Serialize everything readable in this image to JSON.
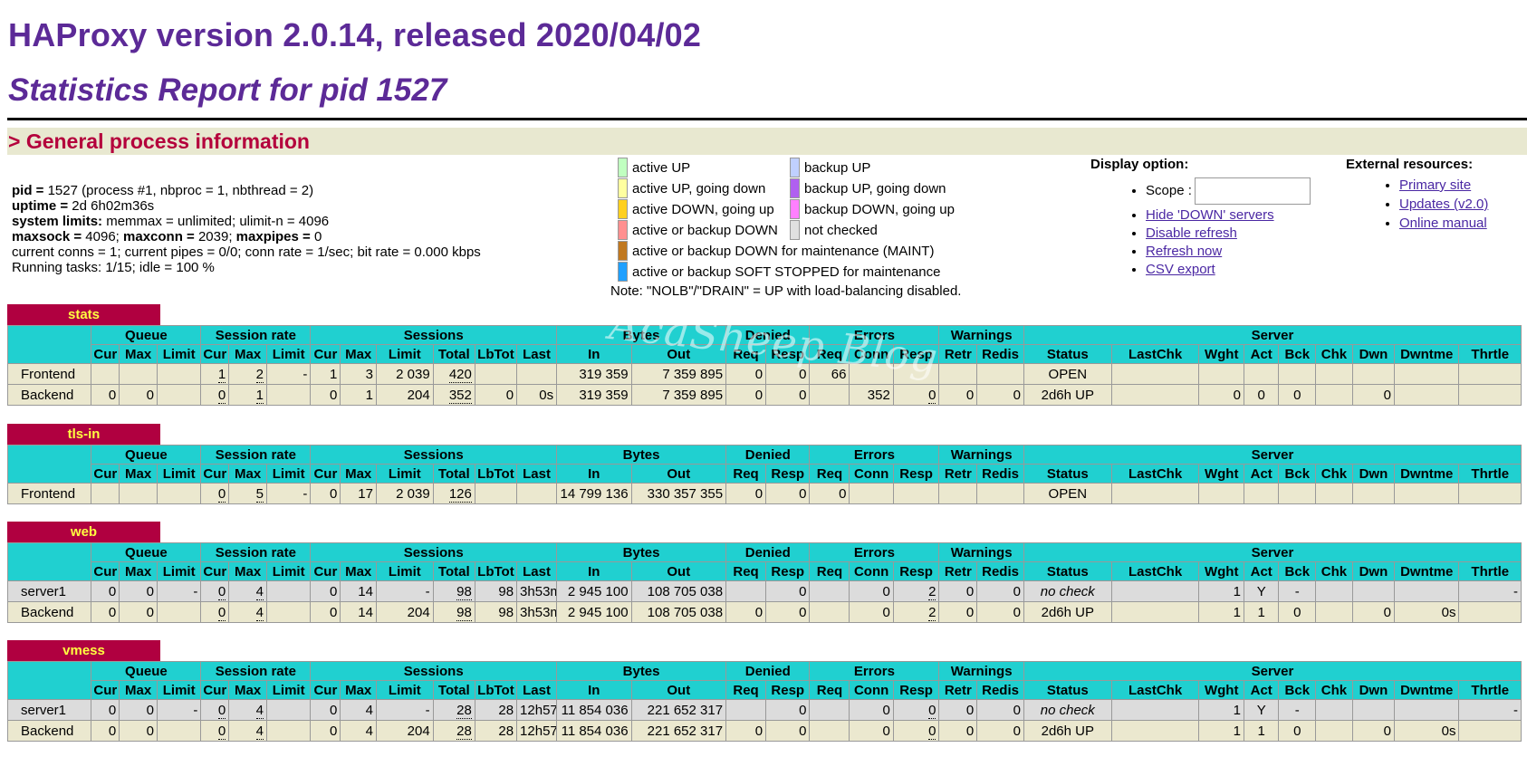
{
  "page": {
    "title": "HAProxy version 2.0.14, released 2020/04/02",
    "subtitle": "Statistics Report for pid 1527",
    "section_title": "> General process information"
  },
  "process": {
    "pid_label": "pid =",
    "pid_value": " 1527 (process #1, nbproc = 1, nbthread = 2)",
    "uptime_label": "uptime =",
    "uptime_value": " 2d 6h02m36s",
    "limits_label": "system limits:",
    "limits_value": " memmax = unlimited; ulimit-n = 4096",
    "maxsock_label": "maxsock =",
    "maxsock_value": " 4096; ",
    "maxconn_label": "maxconn =",
    "maxconn_value": " 2039; ",
    "maxpipes_label": "maxpipes =",
    "maxpipes_value": " 0",
    "conns_line": "current conns = 1; current pipes = 0/0; conn rate = 1/sec; bit rate = 0.000 kbps",
    "tasks_line": "Running tasks: 1/15; idle = 100 %"
  },
  "legend": {
    "col1": [
      {
        "label": "active UP",
        "color": "#c0ffc0"
      },
      {
        "label": "active UP, going down",
        "color": "#ffffa0"
      },
      {
        "label": "active DOWN, going up",
        "color": "#ffd020"
      },
      {
        "label": "active or backup DOWN",
        "color": "#ff9090"
      }
    ],
    "col2": [
      {
        "label": "backup UP",
        "color": "#c0d0ff"
      },
      {
        "label": "backup UP, going down",
        "color": "#b060f0"
      },
      {
        "label": "backup DOWN, going up",
        "color": "#ff80ff"
      },
      {
        "label": "not checked",
        "color": "#e0e0e0"
      }
    ],
    "wide": [
      {
        "label": "active or backup DOWN for maintenance (MAINT)",
        "color": "#c07820"
      },
      {
        "label": "active or backup SOFT STOPPED for maintenance",
        "color": "#20a0ff"
      }
    ],
    "note": "Note: \"NOLB\"/\"DRAIN\" = UP with load-balancing disabled."
  },
  "display": {
    "title": "Display option:",
    "scope_label": "Scope :",
    "scope_value": "",
    "links": [
      "Hide 'DOWN' servers",
      "Disable refresh",
      "Refresh now",
      "CSV export"
    ]
  },
  "external": {
    "title": "External resources:",
    "links": [
      "Primary site",
      "Updates (v2.0)",
      "Online manual"
    ]
  },
  "watermark": "AcaSheep Blog",
  "header_groups": [
    "Queue",
    "Session rate",
    "Sessions",
    "Bytes",
    "Denied",
    "Errors",
    "Warnings",
    "Server"
  ],
  "header_cols": [
    "Cur",
    "Max",
    "Limit",
    "Cur",
    "Max",
    "Limit",
    "Cur",
    "Max",
    "Limit",
    "Total",
    "LbTot",
    "Last",
    "In",
    "Out",
    "Req",
    "Resp",
    "Req",
    "Conn",
    "Resp",
    "Retr",
    "Redis",
    "Status",
    "LastChk",
    "Wght",
    "Act",
    "Bck",
    "Chk",
    "Dwn",
    "Dwntme",
    "Thrtle"
  ],
  "proxies": [
    {
      "name": "stats",
      "rows": [
        {
          "kind": "fe",
          "cells": [
            "Frontend",
            "",
            "",
            "",
            "1",
            "2",
            "-",
            "1",
            "3",
            "2 039",
            "420",
            "",
            "",
            "319 359",
            "7 359 895",
            "0",
            "0",
            "66",
            "",
            "",
            "",
            "",
            "OPEN",
            "",
            "",
            "",
            "",
            "",
            "",
            "",
            ""
          ]
        },
        {
          "kind": "be",
          "cells": [
            "Backend",
            "0",
            "0",
            "",
            "0",
            "1",
            "",
            "0",
            "1",
            "204",
            "352",
            "0",
            "0s",
            "319 359",
            "7 359 895",
            "0",
            "0",
            "",
            "352",
            "0",
            "0",
            "0",
            "2d6h UP",
            "",
            "0",
            "0",
            "0",
            "",
            "0",
            "",
            ""
          ]
        }
      ]
    },
    {
      "name": "tls-in",
      "rows": [
        {
          "kind": "fe",
          "cells": [
            "Frontend",
            "",
            "",
            "",
            "0",
            "5",
            "-",
            "0",
            "17",
            "2 039",
            "126",
            "",
            "",
            "14 799 136",
            "330 357 355",
            "0",
            "0",
            "0",
            "",
            "",
            "",
            "",
            "OPEN",
            "",
            "",
            "",
            "",
            "",
            "",
            "",
            ""
          ]
        }
      ]
    },
    {
      "name": "web",
      "rows": [
        {
          "kind": "sv",
          "cells": [
            "server1",
            "0",
            "0",
            "-",
            "0",
            "4",
            "",
            "0",
            "14",
            "-",
            "98",
            "98",
            "3h53m",
            "2 945 100",
            "108 705 038",
            "",
            "0",
            "",
            "0",
            "2",
            "0",
            "0",
            "no check",
            "",
            "1",
            "Y",
            "-",
            "",
            "",
            "",
            "-"
          ]
        },
        {
          "kind": "be",
          "cells": [
            "Backend",
            "0",
            "0",
            "",
            "0",
            "4",
            "",
            "0",
            "14",
            "204",
            "98",
            "98",
            "3h53m",
            "2 945 100",
            "108 705 038",
            "0",
            "0",
            "",
            "0",
            "2",
            "0",
            "0",
            "2d6h UP",
            "",
            "1",
            "1",
            "0",
            "",
            "0",
            "0s",
            ""
          ]
        }
      ]
    },
    {
      "name": "vmess",
      "rows": [
        {
          "kind": "sv",
          "cells": [
            "server1",
            "0",
            "0",
            "-",
            "0",
            "4",
            "",
            "0",
            "4",
            "-",
            "28",
            "28",
            "12h57m",
            "11 854 036",
            "221 652 317",
            "",
            "0",
            "",
            "0",
            "0",
            "0",
            "0",
            "no check",
            "",
            "1",
            "Y",
            "-",
            "",
            "",
            "",
            "-"
          ]
        },
        {
          "kind": "be",
          "cells": [
            "Backend",
            "0",
            "0",
            "",
            "0",
            "4",
            "",
            "0",
            "4",
            "204",
            "28",
            "28",
            "12h57m",
            "11 854 036",
            "221 652 317",
            "0",
            "0",
            "",
            "0",
            "0",
            "0",
            "0",
            "2d6h UP",
            "",
            "1",
            "1",
            "0",
            "",
            "0",
            "0s",
            ""
          ]
        }
      ]
    }
  ]
}
